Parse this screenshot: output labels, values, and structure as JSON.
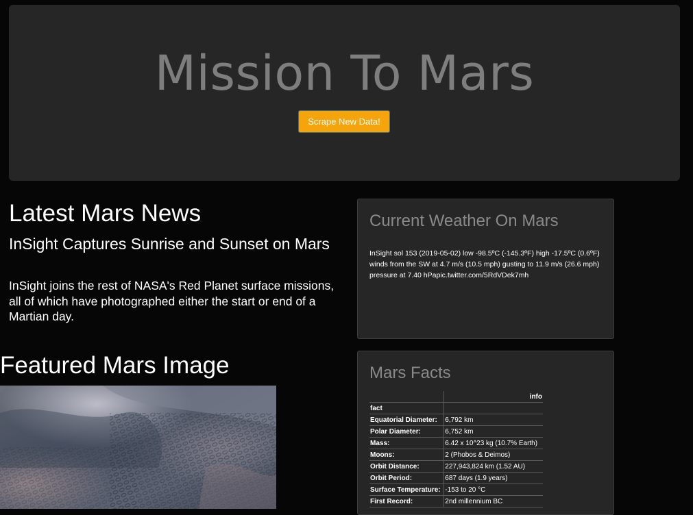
{
  "header": {
    "title": "Mission To Mars",
    "scrape_button": "Scrape New Data!"
  },
  "news": {
    "heading": "Latest Mars News",
    "title": "InSight Captures Sunrise and Sunset on Mars",
    "paragraph": "InSight joins the rest of NASA's Red Planet surface missions, all of which have photographed either the start or end of a Martian day."
  },
  "featured_image": {
    "heading": "Featured Mars Image"
  },
  "weather": {
    "heading": "Current Weather On Mars",
    "text": "InSight sol 153 (2019-05-02) low -98.5ºC (-145.3ºF) high -17.5ºC (0.6ºF) winds from the SW at 4.7 m/s (10.5 mph) gusting to 11.9 m/s (26.6 mph) pressure at 7.40 hPapic.twitter.com/5RdVDek7mh"
  },
  "facts": {
    "heading": "Mars Facts",
    "column_header": "info",
    "index_header": "fact",
    "rows": [
      {
        "fact": "Equatorial Diameter:",
        "info": "6,792 km"
      },
      {
        "fact": "Polar Diameter:",
        "info": "6,752 km"
      },
      {
        "fact": "Mass:",
        "info": "6.42 x 10^23 kg (10.7% Earth)"
      },
      {
        "fact": "Moons:",
        "info": "2 (Phobos & Deimos)"
      },
      {
        "fact": "Orbit Distance:",
        "info": "227,943,824 km (1.52 AU)"
      },
      {
        "fact": "Orbit Period:",
        "info": "687 days (1.9 years)"
      },
      {
        "fact": "Surface Temperature:",
        "info": "-153 to 20 °C"
      },
      {
        "fact": "First Record:",
        "info": "2nd millennium BC"
      }
    ]
  },
  "colors": {
    "background": "#060606",
    "jumbotron": "#262626",
    "title_gray": "#7e7e7e",
    "button": "#f5a40b",
    "panel_heading": "#8a8a8a"
  }
}
